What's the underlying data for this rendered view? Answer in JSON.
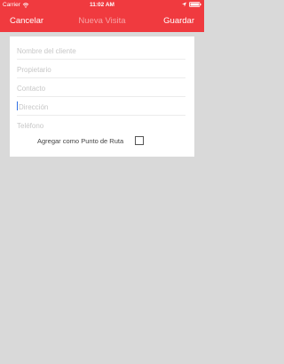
{
  "status_bar": {
    "carrier": "Carrier",
    "time": "11:02 AM"
  },
  "nav": {
    "cancel_label": "Cancelar",
    "title": "Nueva Visita",
    "save_label": "Guardar"
  },
  "form": {
    "client_name": {
      "placeholder": "Nombre del cliente",
      "value": ""
    },
    "owner": {
      "placeholder": "Propietario",
      "value": ""
    },
    "contact": {
      "placeholder": "Contacto",
      "value": ""
    },
    "address": {
      "placeholder": "Dirección",
      "value": ""
    },
    "phone": {
      "placeholder": "Teléfono",
      "value": ""
    },
    "route_point_label": "Agregar como Punto de Ruta",
    "route_point_checked": false
  },
  "colors": {
    "header": "#f03a3f",
    "background": "#d9d9d9",
    "title_dim": "#f7a3a6"
  },
  "icons": {
    "status_left": "wifi-icon",
    "status_right": [
      "location-icon",
      "battery-icon"
    ]
  }
}
